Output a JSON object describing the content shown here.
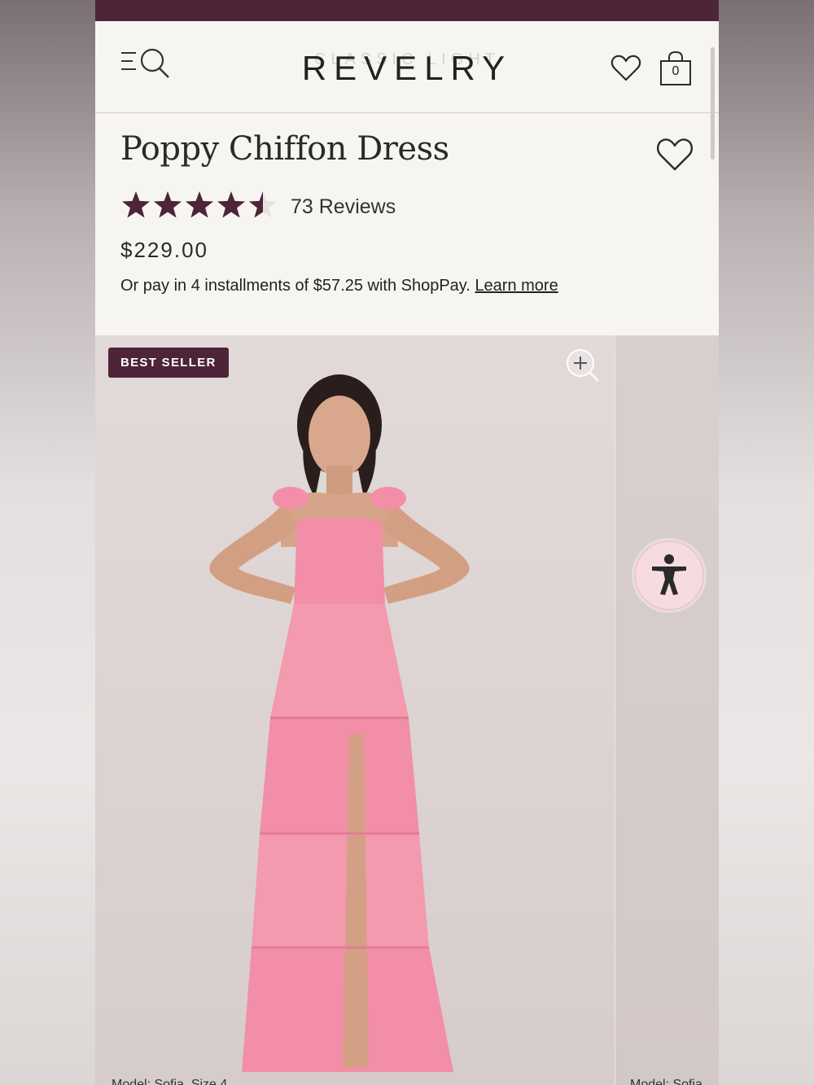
{
  "header": {
    "brand": "REVELRY",
    "brand_ghost": "CLASSIC LIGHT",
    "bag_count": "0",
    "icons": [
      "menu-search-icon",
      "heart-icon",
      "shopping-bag-icon"
    ]
  },
  "product": {
    "title": "Poppy Chiffon Dress",
    "rating": 4.5,
    "rating_max": 5,
    "reviews_label": "73 Reviews",
    "price": "$229.00",
    "installments_text": "Or pay in 4 installments of $57.25 with ShopPay.",
    "learn_more": "Learn more"
  },
  "gallery": {
    "badge": "BEST SELLER",
    "caption_left": "Model: Sofia, Size 4",
    "caption_right": "Model: Sofia",
    "icons": [
      "zoom-in-icon",
      "accessibility-icon"
    ]
  },
  "colors": {
    "brand": "#4d2438",
    "background": "#f7f5f2",
    "dress": "#f28ea7",
    "accessibility_button": "#f6dce0"
  }
}
